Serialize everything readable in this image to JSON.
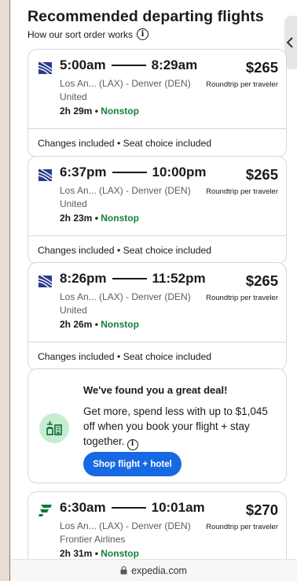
{
  "header": {
    "title": "Recommended departing flights",
    "subtitle": "How our sort order works",
    "info_glyph": "i"
  },
  "flights": [
    {
      "depart": "5:00am",
      "arrive": "8:29am",
      "route": "Los An... (LAX) - Denver (DEN)",
      "airline": "United",
      "duration": "2h 29m",
      "separator": "•",
      "stops": "Nonstop",
      "price": "$265",
      "price_note": "Roundtrip per traveler",
      "perks": "Changes included • Seat choice included",
      "logo_icon": "united-logo-icon"
    },
    {
      "depart": "6:37pm",
      "arrive": "10:00pm",
      "route": "Los An... (LAX) - Denver (DEN)",
      "airline": "United",
      "duration": "2h 23m",
      "separator": "•",
      "stops": "Nonstop",
      "price": "$265",
      "price_note": "Roundtrip per traveler",
      "perks": "Changes included • Seat choice included",
      "logo_icon": "united-logo-icon"
    },
    {
      "depart": "8:26pm",
      "arrive": "11:52pm",
      "route": "Los An... (LAX) - Denver (DEN)",
      "airline": "United",
      "duration": "2h 26m",
      "separator": "•",
      "stops": "Nonstop",
      "price": "$265",
      "price_note": "Roundtrip per traveler",
      "perks": "Changes included • Seat choice included",
      "logo_icon": "united-logo-icon"
    },
    {
      "depart": "6:30am",
      "arrive": "10:01am",
      "route": "Los An... (LAX) - Denver (DEN)",
      "airline": "Frontier Airlines",
      "duration": "2h 31m",
      "separator": "•",
      "stops": "Nonstop",
      "price": "$270",
      "price_note": "Roundtrip per traveler",
      "logo_icon": "frontier-logo-icon"
    }
  ],
  "deal": {
    "title": "We've found you a great deal!",
    "text": "Get more, spend less with up to $1,045 off when you book your flight + stay together.",
    "button": "Shop flight + hotel",
    "icon": "flight-hotel-bundle-icon"
  },
  "browser": {
    "url": "expedia.com",
    "icon": "lock-icon"
  },
  "colors": {
    "accent": "#1668e3",
    "nonstop": "#16803c",
    "deal_icon_bg": "#c8ecd2",
    "frontier": "#0a7a3e",
    "united": "#2b3a8f"
  }
}
